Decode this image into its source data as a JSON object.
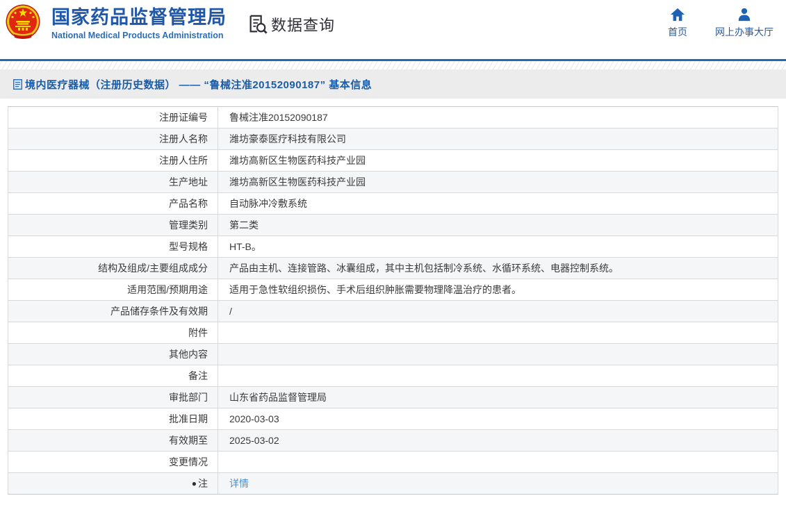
{
  "header": {
    "emblem_name": "national-emblem",
    "title_cn": "国家药品监督管理局",
    "title_en": "National Medical Products Administration",
    "section_label": "数据查询",
    "nav": [
      {
        "label": "首页",
        "icon": "home-icon"
      },
      {
        "label": "网上办事大厅",
        "icon": "user-icon"
      }
    ]
  },
  "page_title": "境内医疗器械（注册历史数据） —— “鲁械注准20152090187” 基本信息",
  "icons": {
    "note": "●"
  },
  "colors": {
    "brand_blue": "#2057a7",
    "rule_blue": "#2269b3",
    "title_blue": "#1a5ca8",
    "link_blue": "#4a90d2",
    "row_alt_bg": "#f5f6f7",
    "emblem_red": "#de2910",
    "emblem_gold": "#f0c419"
  },
  "table": {
    "rows": [
      {
        "label": "注册证编号",
        "value": "鲁械注准20152090187"
      },
      {
        "label": "注册人名称",
        "value": "潍坊豪泰医疗科技有限公司"
      },
      {
        "label": "注册人住所",
        "value": "潍坊高新区生物医药科技产业园"
      },
      {
        "label": "生产地址",
        "value": "潍坊高新区生物医药科技产业园"
      },
      {
        "label": "产品名称",
        "value": "自动脉冲冷敷系统"
      },
      {
        "label": "管理类别",
        "value": "第二类"
      },
      {
        "label": "型号规格",
        "value": "HT-B。"
      },
      {
        "label": "结构及组成/主要组成成分",
        "value": "产品由主机、连接管路、冰囊组成，其中主机包括制冷系统、水循环系统、电器控制系统。"
      },
      {
        "label": "适用范围/预期用途",
        "value": "适用于急性软组织损伤、手术后组织肿胀需要物理降温治疗的患者。"
      },
      {
        "label": "产品储存条件及有效期",
        "value": "/"
      },
      {
        "label": "附件",
        "value": ""
      },
      {
        "label": "其他内容",
        "value": ""
      },
      {
        "label": "备注",
        "value": ""
      },
      {
        "label": "审批部门",
        "value": "山东省药品监督管理局"
      },
      {
        "label": "批准日期",
        "value": "2020-03-03"
      },
      {
        "label": "有效期至",
        "value": "2025-03-02"
      },
      {
        "label": "变更情况",
        "value": ""
      },
      {
        "label": "注",
        "value": "详情",
        "value_is_link": true,
        "label_has_note_icon": true
      }
    ]
  }
}
